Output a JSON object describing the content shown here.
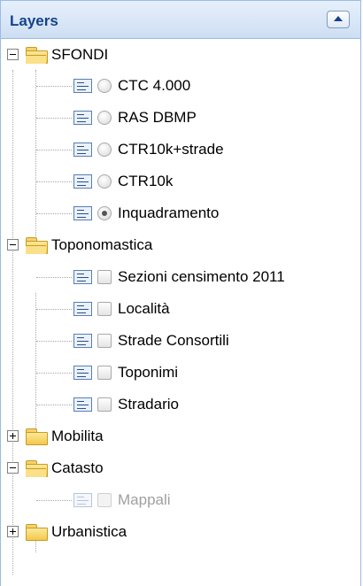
{
  "panel": {
    "title": "Layers"
  },
  "tree": {
    "sfondi": {
      "label": "SFONDI",
      "items": [
        {
          "label": "CTC 4.000",
          "checked": false
        },
        {
          "label": "RAS DBMP",
          "checked": false
        },
        {
          "label": "CTR10k+strade",
          "checked": false
        },
        {
          "label": "CTR10k",
          "checked": false
        },
        {
          "label": "Inquadramento",
          "checked": true
        }
      ]
    },
    "toponomastica": {
      "label": "Toponomastica",
      "items": [
        {
          "label": "Sezioni censimento 2011",
          "checked": false
        },
        {
          "label": "Località",
          "checked": false
        },
        {
          "label": "Strade Consortili",
          "checked": false
        },
        {
          "label": "Toponimi",
          "checked": false
        },
        {
          "label": "Stradario",
          "checked": false
        }
      ]
    },
    "mobilita": {
      "label": "Mobilita"
    },
    "catasto": {
      "label": "Catasto",
      "items": [
        {
          "label": "Mappali",
          "checked": false,
          "disabled": true
        }
      ]
    },
    "urbanistica": {
      "label": "Urbanistica"
    }
  }
}
